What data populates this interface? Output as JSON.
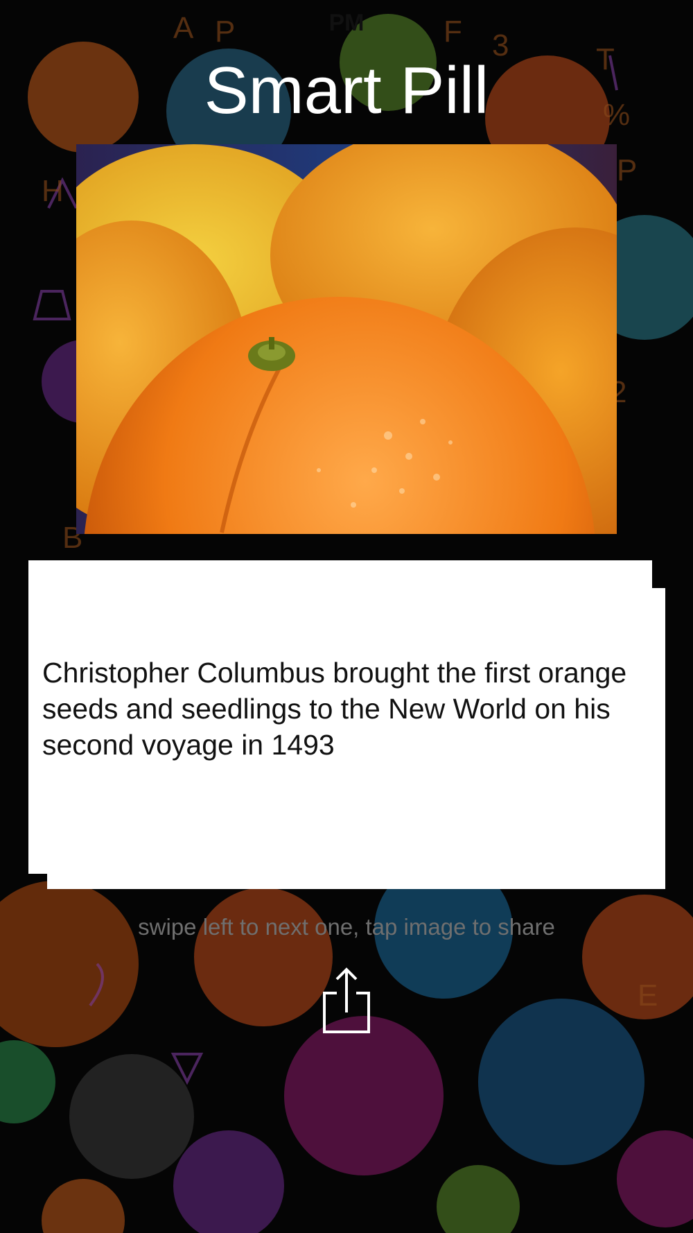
{
  "status_bar": {
    "time": "  PM"
  },
  "app": {
    "title": "Smart Pill"
  },
  "fact": {
    "image_subject": "oranges",
    "text": "Christopher Columbus brought the first orange seeds and seedlings to the New World on his second voyage in 1493"
  },
  "hint": {
    "text": "swipe left to next one, tap image to share"
  },
  "share": {
    "icon": "share-icon"
  },
  "theme": {
    "background": "#050505",
    "card": "#ffffff",
    "title_color": "#ffffff",
    "hint_color": "#6f6f6f"
  }
}
